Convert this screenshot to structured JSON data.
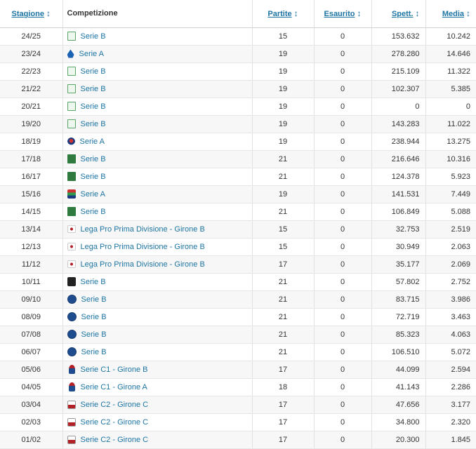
{
  "headers": {
    "stagione": "Stagione",
    "competizione": "Competizione",
    "partite": "Partite",
    "esaurito": "Esaurito",
    "spett": "Spett.",
    "media": "Media",
    "sort_arrow": "↕"
  },
  "rows": [
    {
      "season": "24/25",
      "competition": "Serie B",
      "logo_icon": "serie-b-logo-icon",
      "matches": "15",
      "sold_out": "0",
      "spectators": "153.632",
      "average": "10.242"
    },
    {
      "season": "23/24",
      "competition": "Serie A",
      "logo_icon": "serie-a-logo-icon",
      "matches": "19",
      "sold_out": "0",
      "spectators": "278.280",
      "average": "14.646"
    },
    {
      "season": "22/23",
      "competition": "Serie B",
      "logo_icon": "serie-b-logo-icon",
      "matches": "19",
      "sold_out": "0",
      "spectators": "215.109",
      "average": "11.322"
    },
    {
      "season": "21/22",
      "competition": "Serie B",
      "logo_icon": "serie-b-logo-icon",
      "matches": "19",
      "sold_out": "0",
      "spectators": "102.307",
      "average": "5.385"
    },
    {
      "season": "20/21",
      "competition": "Serie B",
      "logo_icon": "serie-b-logo-icon",
      "matches": "19",
      "sold_out": "0",
      "spectators": "0",
      "average": "0"
    },
    {
      "season": "19/20",
      "competition": "Serie B",
      "logo_icon": "serie-b-logo-icon",
      "matches": "19",
      "sold_out": "0",
      "spectators": "143.283",
      "average": "11.022"
    },
    {
      "season": "18/19",
      "competition": "Serie A",
      "logo_icon": "serie-a-logo-icon",
      "matches": "19",
      "sold_out": "0",
      "spectators": "238.944",
      "average": "13.275"
    },
    {
      "season": "17/18",
      "competition": "Serie B",
      "logo_icon": "serie-b-logo-icon",
      "matches": "21",
      "sold_out": "0",
      "spectators": "216.646",
      "average": "10.316"
    },
    {
      "season": "16/17",
      "competition": "Serie B",
      "logo_icon": "serie-b-logo-icon",
      "matches": "21",
      "sold_out": "0",
      "spectators": "124.378",
      "average": "5.923"
    },
    {
      "season": "15/16",
      "competition": "Serie A",
      "logo_icon": "serie-a-logo-icon",
      "matches": "19",
      "sold_out": "0",
      "spectators": "141.531",
      "average": "7.449"
    },
    {
      "season": "14/15",
      "competition": "Serie B",
      "logo_icon": "serie-b-logo-icon",
      "matches": "21",
      "sold_out": "0",
      "spectators": "106.849",
      "average": "5.088"
    },
    {
      "season": "13/14",
      "competition": "Lega Pro Prima Divisione - Girone B",
      "logo_icon": "lega-pro-logo-icon",
      "matches": "15",
      "sold_out": "0",
      "spectators": "32.753",
      "average": "2.519"
    },
    {
      "season": "12/13",
      "competition": "Lega Pro Prima Divisione - Girone B",
      "logo_icon": "lega-pro-logo-icon",
      "matches": "15",
      "sold_out": "0",
      "spectators": "30.949",
      "average": "2.063"
    },
    {
      "season": "11/12",
      "competition": "Lega Pro Prima Divisione - Girone B",
      "logo_icon": "lega-pro-logo-icon",
      "matches": "17",
      "sold_out": "0",
      "spectators": "35.177",
      "average": "2.069"
    },
    {
      "season": "10/11",
      "competition": "Serie B",
      "logo_icon": "serie-b-logo-icon",
      "matches": "21",
      "sold_out": "0",
      "spectators": "57.802",
      "average": "2.752"
    },
    {
      "season": "09/10",
      "competition": "Serie B",
      "logo_icon": "serie-b-ball-logo-icon",
      "matches": "21",
      "sold_out": "0",
      "spectators": "83.715",
      "average": "3.986"
    },
    {
      "season": "08/09",
      "competition": "Serie B",
      "logo_icon": "serie-b-ball-logo-icon",
      "matches": "21",
      "sold_out": "0",
      "spectators": "72.719",
      "average": "3.463"
    },
    {
      "season": "07/08",
      "competition": "Serie B",
      "logo_icon": "serie-b-ball-logo-icon",
      "matches": "21",
      "sold_out": "0",
      "spectators": "85.323",
      "average": "4.063"
    },
    {
      "season": "06/07",
      "competition": "Serie B",
      "logo_icon": "serie-b-ball-logo-icon",
      "matches": "21",
      "sold_out": "0",
      "spectators": "106.510",
      "average": "5.072"
    },
    {
      "season": "05/06",
      "competition": "Serie C1 - Girone B",
      "logo_icon": "serie-c1-logo-icon",
      "matches": "17",
      "sold_out": "0",
      "spectators": "44.099",
      "average": "2.594"
    },
    {
      "season": "04/05",
      "competition": "Serie C1 - Girone A",
      "logo_icon": "serie-c1-logo-icon",
      "matches": "18",
      "sold_out": "0",
      "spectators": "41.143",
      "average": "2.286"
    },
    {
      "season": "03/04",
      "competition": "Serie C2 - Girone C",
      "logo_icon": "serie-c2-logo-icon",
      "matches": "17",
      "sold_out": "0",
      "spectators": "47.656",
      "average": "3.177"
    },
    {
      "season": "02/03",
      "competition": "Serie C2 - Girone C",
      "logo_icon": "serie-c2-logo-icon",
      "matches": "17",
      "sold_out": "0",
      "spectators": "34.800",
      "average": "2.320"
    },
    {
      "season": "01/02",
      "competition": "Serie C2 - Girone C",
      "logo_icon": "serie-c2-logo-icon",
      "matches": "17",
      "sold_out": "0",
      "spectators": "20.300",
      "average": "1.845"
    }
  ],
  "colors": {
    "link": "#1d75a3",
    "row_alt": "#f7f7f7",
    "border": "#e2e2e2"
  }
}
